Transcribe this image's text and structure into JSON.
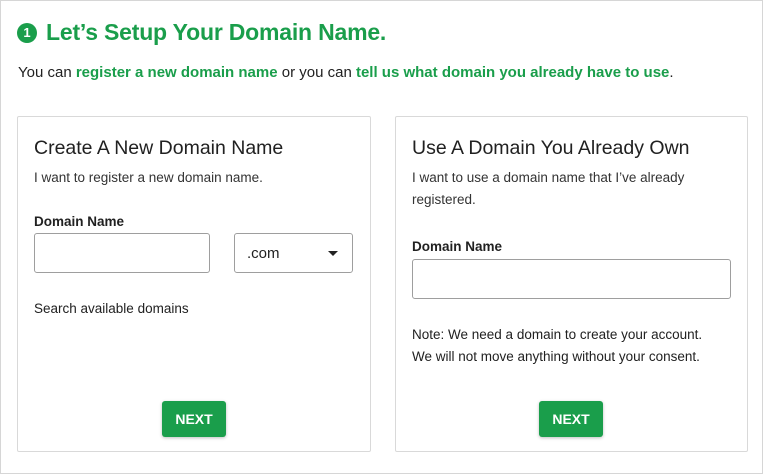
{
  "header": {
    "step_number": "1",
    "title": "Let’s Setup Your Domain Name."
  },
  "intro": {
    "prefix": "You can ",
    "register_link": "register a new domain name",
    "middle": " or you can ",
    "existing_link": "tell us what domain you already have to use",
    "suffix": "."
  },
  "new_domain": {
    "title": "Create A New Domain Name",
    "description": "I want to register a new domain name.",
    "field_label": "Domain Name",
    "input_value": "",
    "tld_selected": ".com",
    "search_link": "Search available domains",
    "next_label": "NEXT"
  },
  "existing_domain": {
    "title": "Use A Domain You Already Own",
    "description": "I want to use a domain name that I’ve already registered.",
    "field_label": "Domain Name",
    "input_value": "",
    "note_line1": "Note: We need a domain to create your account.",
    "note_line2": "We will not move anything without your consent.",
    "next_label": "NEXT"
  },
  "colors": {
    "accent": "#1a9e4b",
    "border": "#d9d9d9",
    "input_border": "#9e9e9e"
  },
  "icons": {
    "tld_dropdown": "caret-down-icon"
  }
}
